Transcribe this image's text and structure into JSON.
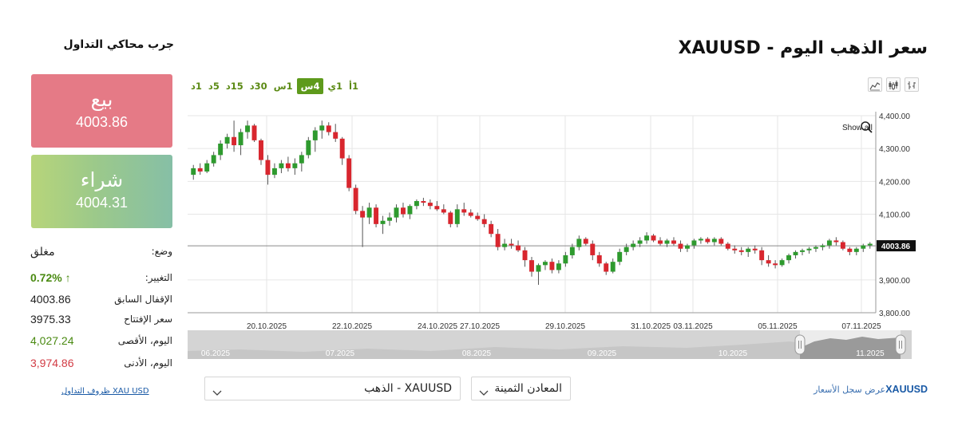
{
  "header": {
    "title": "سعر الذهب اليوم - XAUUSD",
    "simulator_title": "جرب محاكي التداول"
  },
  "timeframes": [
    {
      "label": "1أ",
      "active": false
    },
    {
      "label": "1ي",
      "active": false
    },
    {
      "label": "4س",
      "active": true
    },
    {
      "label": "1س",
      "active": false
    },
    {
      "label": "30د",
      "active": false
    },
    {
      "label": "15د",
      "active": false
    },
    {
      "label": "5د",
      "active": false
    },
    {
      "label": "1د",
      "active": false
    }
  ],
  "chart_types": [
    "area-chart-icon",
    "candlestick-icon",
    "bar-chart-icon"
  ],
  "sell": {
    "label": "بيع",
    "price": "4003.86",
    "color": "#e57a86"
  },
  "buy": {
    "label": "شراء",
    "price": "4004.31",
    "color": "#9cc98a"
  },
  "info": {
    "status_label": "وضع:",
    "status_value": "مغلق",
    "change_label": "التغيير:",
    "change_value": "0.72% ↑",
    "prev_close_label": "الإقفال السابق",
    "prev_close_value": "4003.86",
    "open_label": "سعر الإفتتاح",
    "open_value": "3975.33",
    "high_label": "اليوم، الأقصى",
    "high_value": "4,027.24",
    "low_label": "اليوم، الأدنى",
    "low_value": "3,974.86"
  },
  "trade_terms_link": "XAU USD ظروف التداول",
  "selects": {
    "instrument": "XAUUSD - الذهب",
    "category": "المعادن الثمينة"
  },
  "bottom_link": {
    "symbol": "XAUUSD",
    "text": "عرض سجل الأسعار"
  },
  "colors": {
    "up": "#2e9a2e",
    "down": "#d8262e",
    "accent": "#5e9a1c"
  },
  "chart_data": {
    "type": "candlestick",
    "title": "",
    "xlabel": "",
    "ylabel": "",
    "ylim": [
      3800,
      4400
    ],
    "y_ticks": [
      "4,400.00",
      "4,300.00",
      "4,200.00",
      "4,100.00",
      "3,900.00",
      "3,800.00"
    ],
    "y_tick_values": [
      4400,
      4300,
      4200,
      4100,
      3900,
      3800
    ],
    "x_tick_labels": [
      "20.10.2025",
      "22.10.2025",
      "24.10.2025",
      "27.10.2025",
      "29.10.2025",
      "31.10.2025",
      "03.11.2025",
      "05.11.2025",
      "07.11.2025"
    ],
    "last_price_label": "4003.86",
    "last_price": 4003.86,
    "show_all_label": "Show all",
    "navigator_labels": [
      "06.2025",
      "07.2025",
      "08.2025",
      "09.2025",
      "10.2025",
      "11.2025"
    ],
    "candles": [
      [
        4220,
        4250,
        4205,
        4240
      ],
      [
        4240,
        4255,
        4220,
        4230
      ],
      [
        4230,
        4265,
        4225,
        4255
      ],
      [
        4255,
        4290,
        4245,
        4280
      ],
      [
        4280,
        4325,
        4265,
        4315
      ],
      [
        4315,
        4345,
        4300,
        4335
      ],
      [
        4335,
        4385,
        4290,
        4310
      ],
      [
        4310,
        4360,
        4280,
        4350
      ],
      [
        4350,
        4385,
        4330,
        4370
      ],
      [
        4370,
        4375,
        4320,
        4325
      ],
      [
        4325,
        4330,
        4250,
        4265
      ],
      [
        4265,
        4280,
        4190,
        4220
      ],
      [
        4220,
        4255,
        4210,
        4240
      ],
      [
        4240,
        4265,
        4225,
        4255
      ],
      [
        4255,
        4275,
        4230,
        4240
      ],
      [
        4240,
        4270,
        4220,
        4255
      ],
      [
        4255,
        4290,
        4230,
        4280
      ],
      [
        4280,
        4335,
        4270,
        4325
      ],
      [
        4325,
        4365,
        4290,
        4355
      ],
      [
        4355,
        4385,
        4330,
        4370
      ],
      [
        4370,
        4380,
        4340,
        4350
      ],
      [
        4350,
        4375,
        4320,
        4330
      ],
      [
        4330,
        4335,
        4250,
        4270
      ],
      [
        4270,
        4280,
        4170,
        4180
      ],
      [
        4180,
        4190,
        4100,
        4110
      ],
      [
        4110,
        4125,
        4000,
        4090
      ],
      [
        4090,
        4135,
        4070,
        4120
      ],
      [
        4120,
        4130,
        4060,
        4070
      ],
      [
        4070,
        4095,
        4040,
        4080
      ],
      [
        4080,
        4105,
        4065,
        4090
      ],
      [
        4090,
        4130,
        4075,
        4120
      ],
      [
        4120,
        4135,
        4090,
        4100
      ],
      [
        4100,
        4130,
        4085,
        4125
      ],
      [
        4125,
        4145,
        4115,
        4140
      ],
      [
        4140,
        4150,
        4125,
        4135
      ],
      [
        4135,
        4145,
        4115,
        4125
      ],
      [
        4125,
        4140,
        4110,
        4115
      ],
      [
        4115,
        4130,
        4100,
        4105
      ],
      [
        4105,
        4110,
        4060,
        4070
      ],
      [
        4070,
        4130,
        4060,
        4115
      ],
      [
        4115,
        4135,
        4095,
        4105
      ],
      [
        4105,
        4115,
        4090,
        4095
      ],
      [
        4095,
        4105,
        4080,
        4085
      ],
      [
        4085,
        4100,
        4060,
        4070
      ],
      [
        4070,
        4080,
        4030,
        4040
      ],
      [
        4040,
        4055,
        3990,
        4000
      ],
      [
        4000,
        4025,
        3990,
        4010
      ],
      [
        4010,
        4025,
        3995,
        4005
      ],
      [
        4005,
        4020,
        3985,
        3990
      ],
      [
        3990,
        4000,
        3940,
        3960
      ],
      [
        3960,
        3970,
        3910,
        3925
      ],
      [
        3925,
        3950,
        3885,
        3945
      ],
      [
        3945,
        3960,
        3930,
        3955
      ],
      [
        3955,
        3965,
        3920,
        3930
      ],
      [
        3930,
        3960,
        3920,
        3950
      ],
      [
        3950,
        3985,
        3940,
        3975
      ],
      [
        3975,
        4010,
        3965,
        4000
      ],
      [
        4000,
        4035,
        3990,
        4025
      ],
      [
        4025,
        4030,
        4005,
        4010
      ],
      [
        4010,
        4020,
        3960,
        3975
      ],
      [
        3975,
        3985,
        3940,
        3950
      ],
      [
        3950,
        3955,
        3915,
        3925
      ],
      [
        3925,
        3965,
        3920,
        3955
      ],
      [
        3955,
        3995,
        3945,
        3985
      ],
      [
        3985,
        4010,
        3975,
        4000
      ],
      [
        4000,
        4020,
        3990,
        4010
      ],
      [
        4010,
        4030,
        4000,
        4020
      ],
      [
        4020,
        4045,
        4010,
        4035
      ],
      [
        4035,
        4040,
        4015,
        4020
      ],
      [
        4020,
        4030,
        4005,
        4010
      ],
      [
        4010,
        4025,
        4000,
        4020
      ],
      [
        4020,
        4030,
        4005,
        4010
      ],
      [
        4010,
        4020,
        3985,
        3995
      ],
      [
        3995,
        4010,
        3985,
        4005
      ],
      [
        4005,
        4025,
        3995,
        4020
      ],
      [
        4020,
        4030,
        4010,
        4025
      ],
      [
        4025,
        4030,
        4010,
        4015
      ],
      [
        4015,
        4030,
        4005,
        4025
      ],
      [
        4025,
        4030,
        4005,
        4010
      ],
      [
        4010,
        4015,
        3990,
        3995
      ],
      [
        3995,
        4005,
        3980,
        3990
      ],
      [
        3990,
        4000,
        3975,
        3985
      ],
      [
        3985,
        4000,
        3970,
        3995
      ],
      [
        3995,
        4005,
        3980,
        3990
      ],
      [
        3990,
        4000,
        3945,
        3960
      ],
      [
        3960,
        3975,
        3940,
        3950
      ],
      [
        3950,
        3960,
        3935,
        3945
      ],
      [
        3945,
        3965,
        3940,
        3960
      ],
      [
        3960,
        3980,
        3950,
        3975
      ],
      [
        3975,
        3990,
        3965,
        3985
      ],
      [
        3985,
        3995,
        3975,
        3990
      ],
      [
        3990,
        4000,
        3980,
        3995
      ],
      [
        3995,
        4005,
        3985,
        4000
      ],
      [
        4000,
        4010,
        3990,
        4005
      ],
      [
        4005,
        4025,
        3995,
        4020
      ],
      [
        4020,
        4030,
        4005,
        4015
      ],
      [
        4015,
        4020,
        3990,
        3995
      ],
      [
        3995,
        4000,
        3975,
        3985
      ],
      [
        3985,
        4000,
        3975,
        3995
      ],
      [
        3995,
        4010,
        3985,
        4005
      ],
      [
        4005,
        4015,
        3995,
        4010
      ]
    ]
  }
}
